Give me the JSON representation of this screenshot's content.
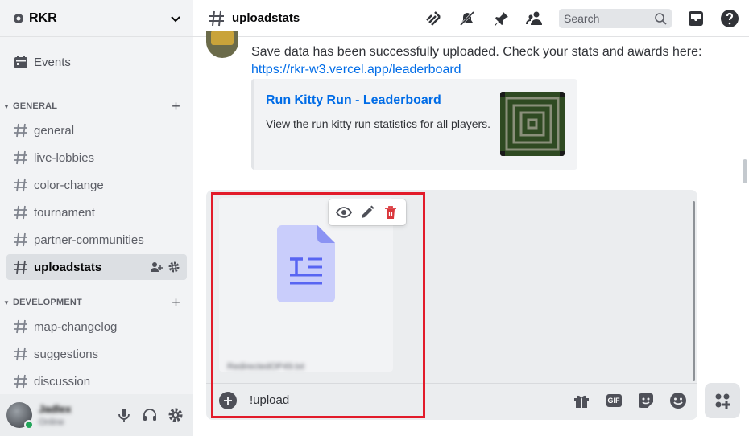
{
  "server": {
    "name": "RKR"
  },
  "sidebar": {
    "events_label": "Events",
    "categories": [
      {
        "label": "GENERAL",
        "channels": [
          "general",
          "live-lobbies",
          "color-change",
          "tournament",
          "partner-communities",
          "uploadstats"
        ]
      },
      {
        "label": "DEVELOPMENT",
        "channels": [
          "map-changelog",
          "suggestions",
          "discussion"
        ]
      }
    ],
    "active_channel": "uploadstats"
  },
  "user": {
    "name": "Jadlex",
    "status": "Online"
  },
  "header": {
    "channel": "uploadstats",
    "search_placeholder": "Search"
  },
  "message": {
    "text": "Save data has been successfully uploaded. Check your stats and awards here:",
    "link": "https://rkr-w3.vercel.app/leaderboard",
    "embed": {
      "title": "Run Kitty Run - Leaderboard",
      "description": "View the run kitty run statistics for all players."
    }
  },
  "composer": {
    "input_value": "!upload",
    "attachment_filename": "RedirectedOP49.txt"
  },
  "colors": {
    "accent": "#5865f2",
    "link": "#006ce7",
    "danger": "#da373c",
    "highlight": "#e21b2a"
  }
}
